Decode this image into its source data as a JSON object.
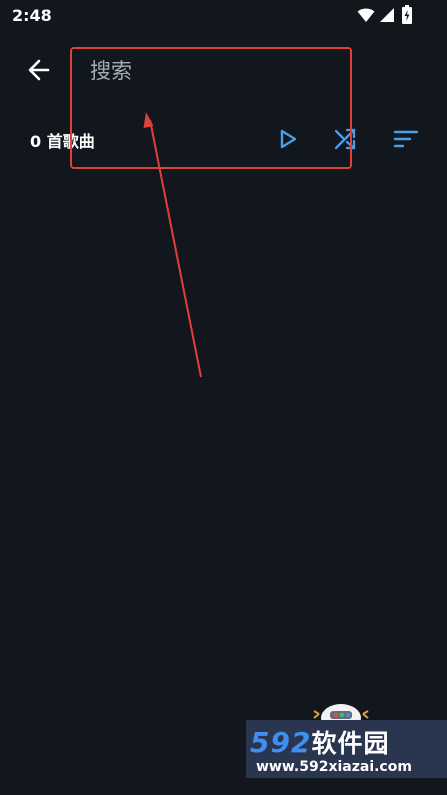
{
  "status_bar": {
    "time": "2:48",
    "icons": [
      "wifi-icon",
      "signal-icon",
      "battery-icon"
    ]
  },
  "toolbar": {
    "back_icon": "arrow-left-icon",
    "search": {
      "value": "",
      "placeholder": "搜索"
    }
  },
  "song_list": {
    "count_label": "0 首歌曲",
    "actions": [
      {
        "name": "play",
        "icon": "play-icon"
      },
      {
        "name": "shuffle",
        "icon": "shuffle-icon"
      },
      {
        "name": "sort",
        "icon": "sort-icon"
      }
    ]
  },
  "colors": {
    "background": "#12161d",
    "accent": "#4a9ee8",
    "annotation": "#e0403a"
  },
  "watermark": {
    "title_number": "592",
    "title_text": "软件园",
    "url": "www.592xiazai.com"
  }
}
